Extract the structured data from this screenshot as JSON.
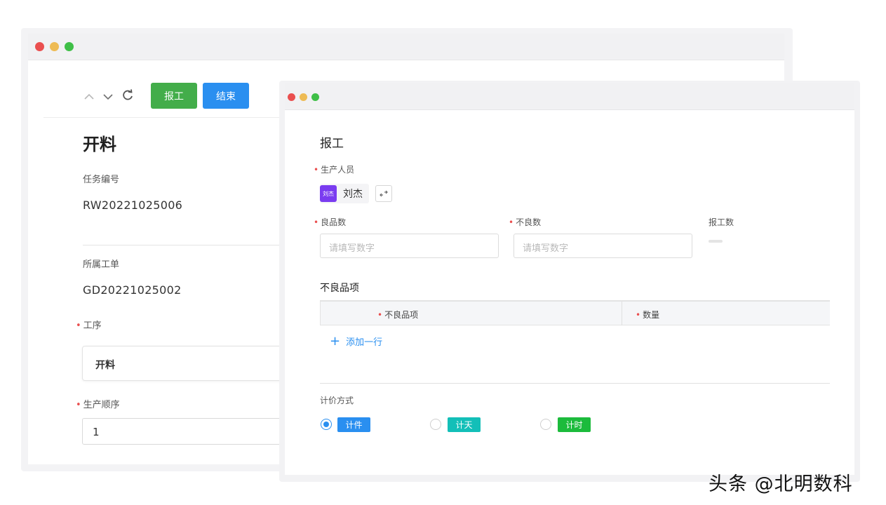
{
  "back_window": {
    "toolbar": {
      "up_icon": "chevron-up-icon",
      "down_icon": "chevron-down-icon",
      "refresh_icon": "refresh-icon",
      "report_button": "报工",
      "end_button": "结束"
    },
    "page_title": "开料",
    "fields": {
      "task_no_label": "任务编号",
      "task_no_value": "RW20221025006",
      "work_order_label": "所属工单",
      "work_order_value": "GD20221025002",
      "process_label": "工序",
      "process_value": "开料",
      "sequence_label": "生产顺序",
      "sequence_value": "1"
    }
  },
  "front_window": {
    "title": "报工",
    "staff_label": "生产人员",
    "staff": {
      "avatar_text": "刘杰",
      "name": "刘杰"
    },
    "good_qty_label": "良品数",
    "good_qty_placeholder": "请填写数字",
    "bad_qty_label": "不良数",
    "bad_qty_placeholder": "请填写数字",
    "report_qty_label": "报工数",
    "defect_section_title": "不良品项",
    "defect_table": {
      "columns": [
        "不良品项",
        "数量"
      ]
    },
    "add_row": "添加一行",
    "pricing_label": "计价方式",
    "pricing_options": [
      {
        "label": "计件",
        "selected": true,
        "color": "#2a8ff0"
      },
      {
        "label": "计天",
        "selected": false,
        "color": "#13bfb8"
      },
      {
        "label": "计时",
        "selected": false,
        "color": "#1cbb3c"
      }
    ]
  },
  "watermark": "头条 @北明数科",
  "colors": {
    "green_button": "#43ad4a",
    "blue_button": "#2a8ff0",
    "required_mark": "#ea4f4f",
    "avatar": "#7a3cf0"
  }
}
